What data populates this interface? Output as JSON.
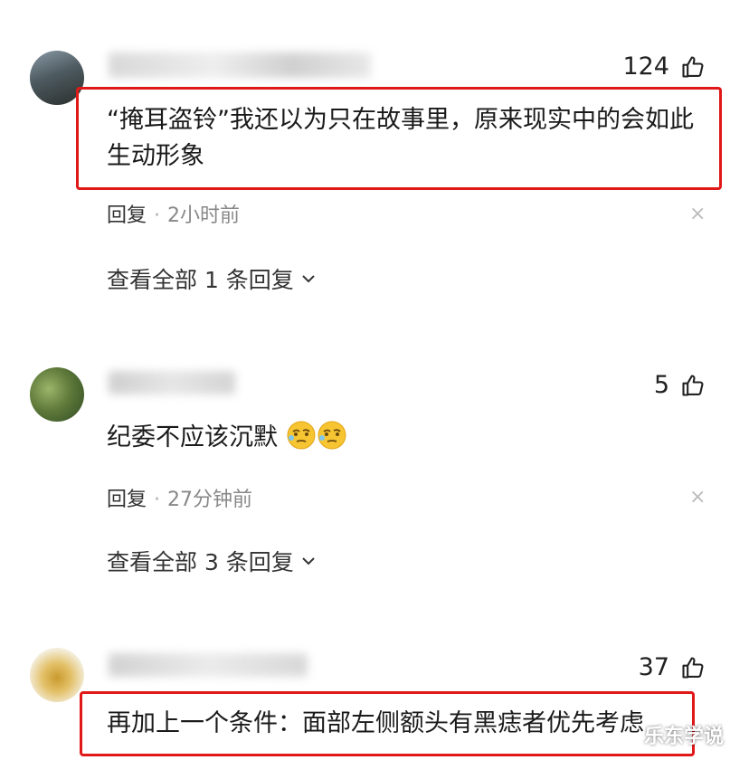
{
  "comments": [
    {
      "likes": "124",
      "text_line1": "“掩耳盗铃”我还以为只在故事里，原来现实中的会如此",
      "text_line2": "生动形象",
      "reply_label": "回复",
      "time": "2小时前",
      "view_replies": "查看全部 1 条回复"
    },
    {
      "likes": "5",
      "text": "纪委不应该沉默",
      "emoji": [
        "thinking-squint-emoji",
        "thinking-squint-emoji"
      ],
      "reply_label": "回复",
      "time": "27分钟前",
      "view_replies": "查看全部 3 条回复"
    },
    {
      "likes": "37",
      "text": "再加上一个条件：面部左侧额头有黑痣者优先考虑"
    }
  ],
  "watermark": "乐东学说",
  "colors": {
    "highlight_border": "#e01818",
    "muted": "#888888"
  }
}
